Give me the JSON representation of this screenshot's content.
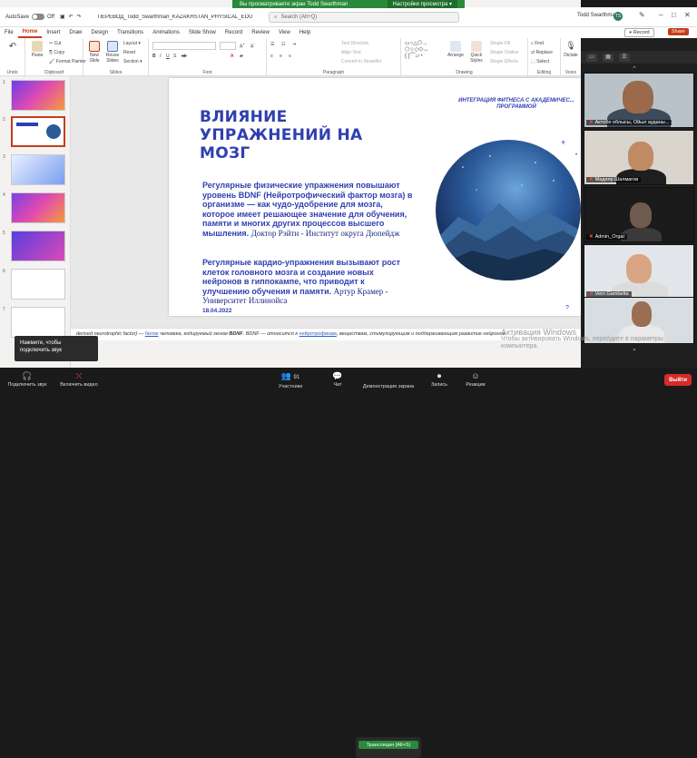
{
  "zoom_banner": {
    "text": "Вы просматриваете экран Todd Swarthman",
    "options": "Настройки просмотра"
  },
  "titlebar": {
    "autosave": "AutoSave",
    "autosave_state": "Off",
    "doc_title": "ПЕРЕВОД_Todd_Swarthman_KAZAKHSTAN_PHYSICAL_EDUCATION_PRES...",
    "search_placeholder": "Search (Alt+Q)",
    "user": "Todd Swarthman",
    "user_initials": "TS"
  },
  "menu": [
    "File",
    "Home",
    "Insert",
    "Draw",
    "Design",
    "Transitions",
    "Animations",
    "Slide Show",
    "Record",
    "Review",
    "View",
    "Help"
  ],
  "menu_active": "Home",
  "record_label": "Record",
  "share_label": "Share",
  "ribbon": {
    "paste": "Paste",
    "cut": "Cut",
    "copy": "Copy",
    "format_painter": "Format Painter",
    "clipboard": "Clipboard",
    "new_slide": "New Slide",
    "reuse_slides": "Reuse Slides",
    "layout": "Layout",
    "reset": "Reset",
    "section": "Section",
    "slides": "Slides",
    "font": "Font",
    "paragraph": "Paragraph",
    "text_direction": "Text Direction",
    "align_text": "Align Text",
    "convert_smartart": "Convert to SmartArt",
    "arrange": "Arrange",
    "quick_styles": "Quick Styles",
    "shape_fill": "Shape Fill",
    "shape_outline": "Shape Outline",
    "shape_effects": "Shape Effects",
    "drawing": "Drawing",
    "find": "Find",
    "replace": "Replace",
    "select": "Select",
    "editing": "Editing",
    "dictate": "Dictate",
    "voice": "Voice",
    "undo": "Undo"
  },
  "slide": {
    "header": "ИНТЕГРАЦИЯ ФИТНЕСА С АКАДЕМИЧЕС... ПРОГРАММОЙ",
    "title": "ВЛИЯНИЕ УПРАЖНЕНИЙ НА МОЗГ",
    "body1": "Регулярные физические упражнения повышают уровень BDNF (Нейротрофический фактор мозга) в организме — как чудо-удобрение для мозга, которое имеет решающее значение для обучения, памяти и многих других процессов высшего мышления.",
    "body1_cite": "Доктор Рэйти - Институт округа Дюпейдж",
    "body2": "Регулярные кардио-упражнения вызывают рост клеток головного мозга и создание новых нейронов в гиппокампе, что приводит к улучшению обучения и памяти.",
    "body2_cite": "Артур Крамер - Университет Иллинойса",
    "date": "18.04.2022"
  },
  "notes": {
    "prefix": "derived neurotrophic factor) —",
    "link1": "белок",
    "mid1": "человека, кодируемый геном",
    "bold": "BDNF",
    "mid2": ". BDNF — относится к",
    "link2": "нейротрофинам",
    "suffix": ", веществам, стимулирующим и поддерживающим развитие нейронов."
  },
  "activate": {
    "line1": "Активация Windows",
    "line2": "Чтобы активировать Windows, перейдите в параметры",
    "line3": "компьютера."
  },
  "tooltip": {
    "line1": "Нажмите, чтобы",
    "line2": "подключить звук"
  },
  "participants": [
    {
      "name": "Актобе облысы, Ойыл ауданы..."
    },
    {
      "name": "Мадияр Шалмагов"
    },
    {
      "name": "Admin_Orgar"
    },
    {
      "name": "Vern Gambetta"
    },
    {
      "name": ""
    }
  ],
  "toolbar": {
    "audio": "Подключить звук",
    "video": "Включить видео",
    "participants": "Участники",
    "participants_count": "91",
    "chat": "Чат",
    "share": "Демонстрация экрана",
    "record": "Запись",
    "reactions": "Реакции",
    "leave": "Выйти",
    "broadcast": "Трансляция (Alt+S)"
  },
  "colors": {
    "ppt_accent": "#c43e1c",
    "slide_blue": "#2f3fb0",
    "zoom_green": "#2a8a3a",
    "leave_red": "#d62b2b"
  }
}
